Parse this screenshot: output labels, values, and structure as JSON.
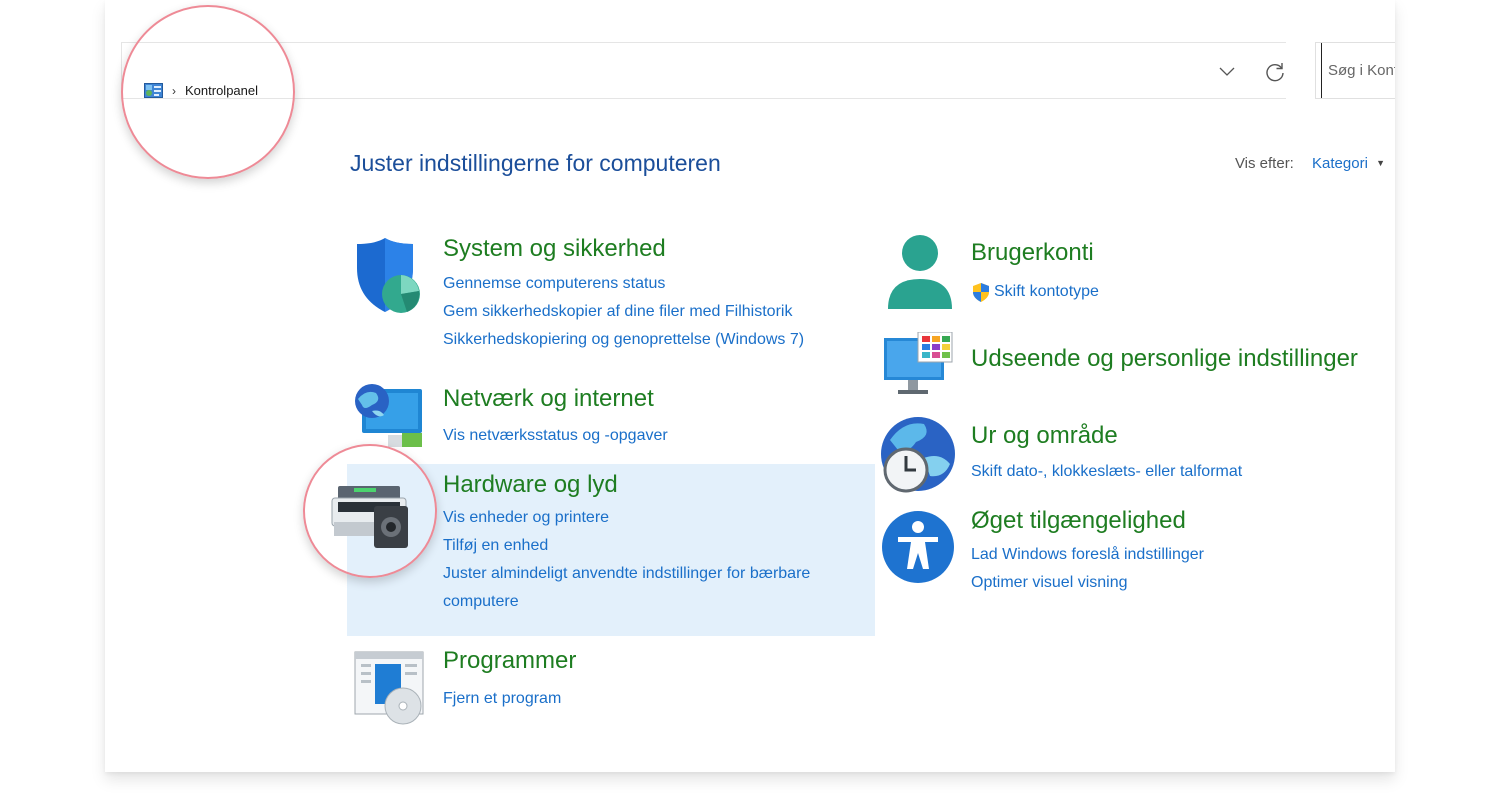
{
  "address": {
    "breadcrumb": [
      "Kontrolpanel"
    ],
    "separator": "›",
    "search_placeholder": "Søg i Kontrolpanel"
  },
  "header": {
    "title": "Juster indstillingerne for computeren",
    "view_by_label": "Vis efter:",
    "view_by_value": "Kategori"
  },
  "categories_left": [
    {
      "title": "System og sikkerhed",
      "icon": "shield-icon",
      "links": [
        "Gennemse computerens status",
        "Gem sikkerhedskopier af dine filer med Filhistorik",
        "Sikkerhedskopiering og genoprettelse (Windows 7)"
      ]
    },
    {
      "title": "Netværk og internet",
      "icon": "network-globe-icon",
      "links": [
        "Vis netværksstatus og -opgaver"
      ]
    },
    {
      "title": "Hardware og lyd",
      "icon": "printer-speaker-icon",
      "links": [
        "Vis enheder og printere",
        "Tilføj en enhed",
        "Juster almindeligt anvendte indstillinger for bærbare",
        "computere"
      ]
    },
    {
      "title": "Programmer",
      "icon": "programs-disc-icon",
      "links": [
        "Fjern et program"
      ]
    }
  ],
  "categories_right": [
    {
      "title": "Brugerkonti",
      "icon": "user-account-icon",
      "links": [
        "Skift kontotype"
      ]
    },
    {
      "title": "Udseende og personlige indstillinger",
      "icon": "monitor-palette-icon",
      "links": []
    },
    {
      "title": "Ur  og område",
      "icon": "globe-clock-icon",
      "links": [
        "Skift dato-, klokkeslæts- eller talformat"
      ]
    },
    {
      "title": "Øget tilgængelighed",
      "icon": "accessibility-icon",
      "links": [
        "Lad Windows foreslå indstillinger",
        "Optimer visuel visning"
      ]
    }
  ],
  "colors": {
    "title_green": "#1e7d21",
    "link_blue": "#1a6fc9",
    "header_blue": "#1b4e9a",
    "hover_bg": "#e3f0fb",
    "highlight_ring": "#ee8a96"
  }
}
